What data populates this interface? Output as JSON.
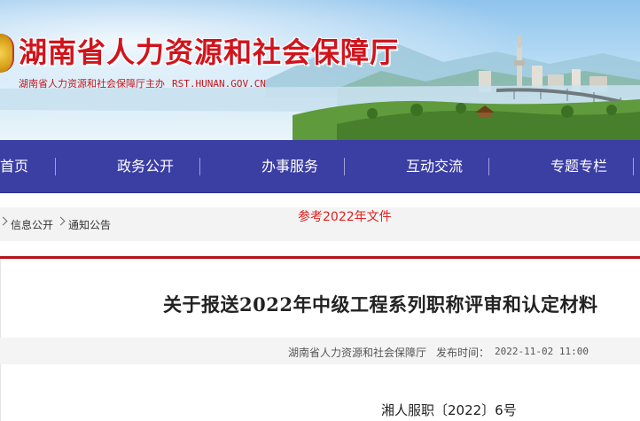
{
  "header": {
    "title": "湖南省人力资源和社会保障厅",
    "sponsor": "湖南省人力资源和社会保障厅主办",
    "url": "RST.HUNAN.GOV.CN",
    "title_color": "#d1141c"
  },
  "nav": {
    "background": "#3b3ea3",
    "items": [
      {
        "label": "首页",
        "icon": null
      },
      {
        "label": "政务公开"
      },
      {
        "label": "办事服务"
      },
      {
        "label": "互动交流"
      },
      {
        "label": "专题专栏"
      }
    ]
  },
  "breadcrumb": {
    "items": [
      {
        "label": "信息公开"
      },
      {
        "label": "通知公告"
      }
    ],
    "separator_icon": "chevron-right-icon"
  },
  "reference_note": "参考2022年文件",
  "article": {
    "title": "关于报送2022年中级工程系列职称评审和认定材料",
    "source": "湖南省人力资源和社会保障厅",
    "published_label": "发布时间：",
    "published_date": "2022-11-02 11:00",
    "doc_number": "湘人服职〔2022〕6号"
  }
}
